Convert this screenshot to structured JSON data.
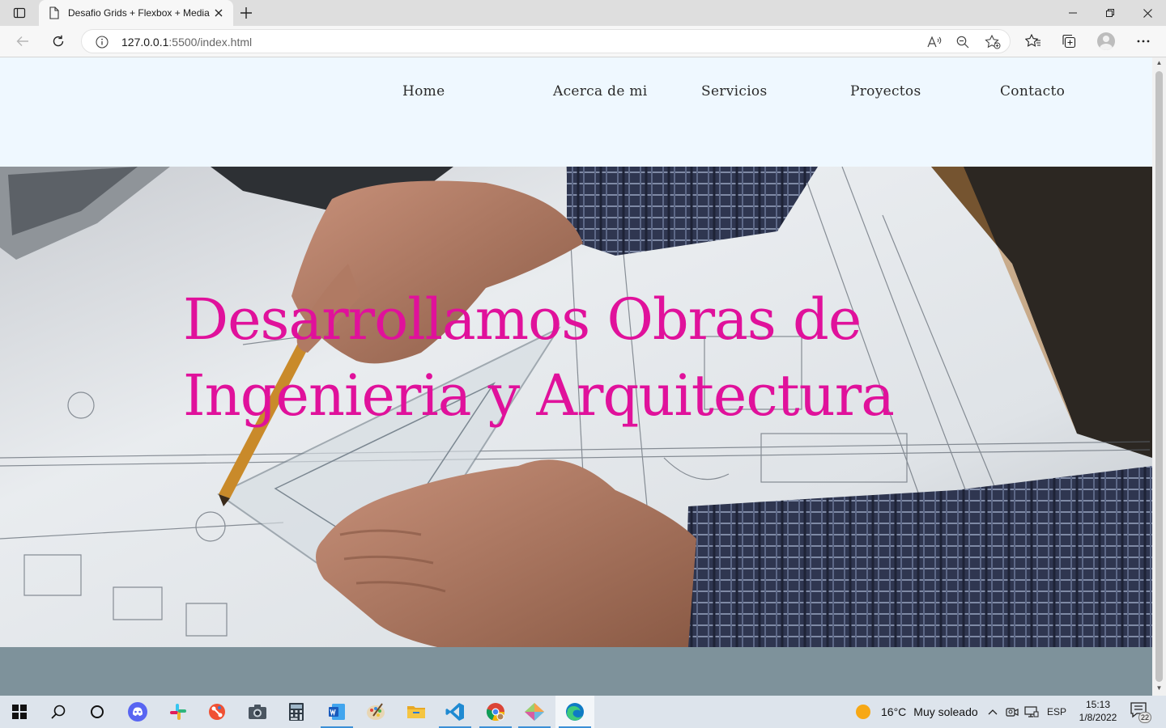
{
  "browser": {
    "tab_title": "Desafio Grids + Flexbox + Media",
    "url_host": "127.0.0.1",
    "url_rest": ":5500/index.html"
  },
  "site": {
    "nav": {
      "home": "Home",
      "about": "Acerca de mi",
      "services": "Servicios",
      "projects": "Proyectos",
      "contact": "Contacto"
    },
    "hero_title": "Desarrollamos Obras de Ingenieria y Arquitectura",
    "colors": {
      "header_bg": "#eff8ff",
      "hero_title": "#e0119b",
      "band": "#7e929b"
    }
  },
  "taskbar": {
    "apps": [
      "start-icon",
      "search-icon",
      "cortana-icon",
      "discord-icon",
      "slack-icon",
      "git-icon",
      "camera-icon",
      "calculator-icon",
      "word-icon",
      "paint-icon",
      "file-explorer-icon",
      "vscode-icon",
      "chrome-icon",
      "gitkraken-icon",
      "edge-icon"
    ],
    "weather_temp": "16°C",
    "weather_desc": "Muy soleado",
    "lang": "ESP",
    "time": "15:13",
    "date": "1/8/2022",
    "notifications": "22"
  }
}
